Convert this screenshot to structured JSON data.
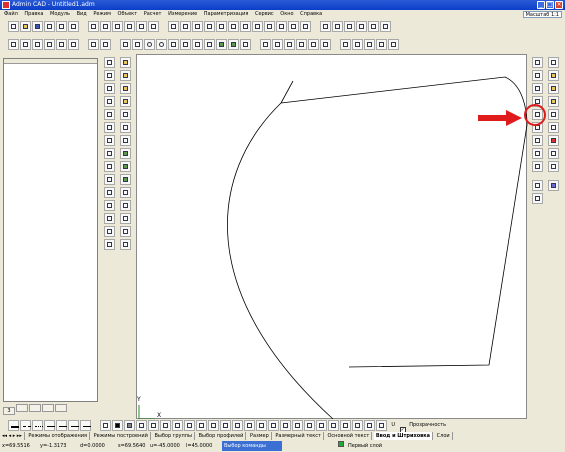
{
  "window": {
    "title": "Admin CAD - Untitled1.adm",
    "minimize_label": "_",
    "maximize_label": "□",
    "close_label": "×"
  },
  "menu": {
    "items": [
      "Файл",
      "Правка",
      "Модуль",
      "Вид",
      "Режим",
      "Объект",
      "Расчет",
      "Измерение",
      "Параметризация",
      "Сервис",
      "Окно",
      "Справка"
    ]
  },
  "scale": {
    "value": "Масштаб 1:1"
  },
  "left_panel": {
    "tabs": [
      "3",
      "",
      "",
      "",
      ""
    ]
  },
  "axes": {
    "y_label": "Y",
    "x_label": "X"
  },
  "bottom_toolbar": {
    "transparency_label": "Прозрачность",
    "transparency_checked": true,
    "u_label": "U"
  },
  "sheet_tabs": {
    "tabs": [
      "Режимы отображения",
      "Режимы построений",
      "Выбор группы",
      "Выбор профилей",
      "Размер",
      "Размерный текст",
      "Основной текст",
      "Ввод и Штриховка",
      "Слои"
    ],
    "active_index": 7
  },
  "status": {
    "x": "x=69.5516",
    "y": "y=-1.3173",
    "d": "d=0.0000",
    "s": "s=69.5640",
    "u": "u=-45.0000",
    "l": "l=45.0000",
    "command": "Выбор команды",
    "layer": "Первый слой"
  },
  "colors": {
    "title_bar": "#0a3ec9",
    "annotation": "#e01b1b",
    "layer_indicator": "#1faa3a",
    "status_command_bg": "#3b6fd4"
  },
  "icons": {
    "annotation_arrow": "red-right-arrow-icon",
    "annotation_circle": "red-highlight-circle"
  }
}
